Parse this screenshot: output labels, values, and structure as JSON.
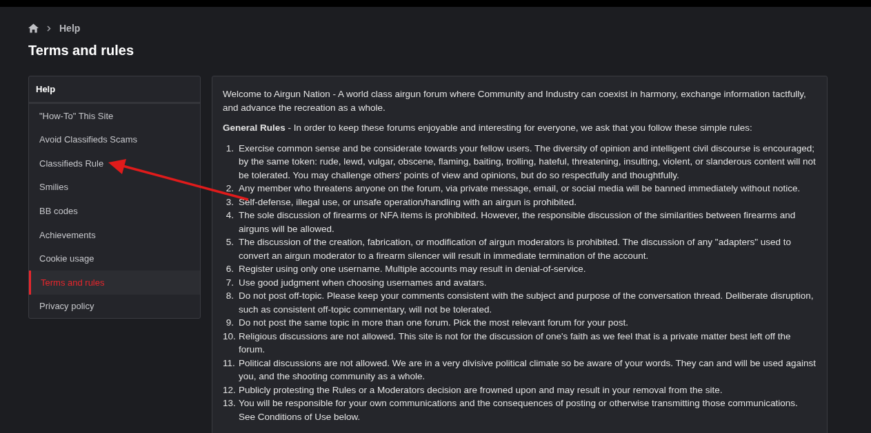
{
  "breadcrumb": {
    "home": true,
    "items": [
      "Help"
    ]
  },
  "page_title": "Terms and rules",
  "sidebar": {
    "title": "Help",
    "items": [
      {
        "label": "\"How-To\" This Site",
        "selected": false
      },
      {
        "label": "Avoid Classifieds Scams",
        "selected": false
      },
      {
        "label": "Classifieds Rule",
        "selected": false
      },
      {
        "label": "Smilies",
        "selected": false
      },
      {
        "label": "BB codes",
        "selected": false
      },
      {
        "label": "Achievements",
        "selected": false
      },
      {
        "label": "Cookie usage",
        "selected": false
      },
      {
        "label": "Terms and rules",
        "selected": true
      },
      {
        "label": "Privacy policy",
        "selected": false
      }
    ]
  },
  "content": {
    "intro": "Welcome to Airgun Nation - A world class airgun forum where Community and Industry can coexist in harmony, exchange information tactfully, and advance the recreation as a whole.",
    "general": "**General Rules** - In order to keep these forums enjoyable and interesting for everyone, we ask that you follow these simple rules:",
    "rules": [
      {
        "number": "1.",
        "text": "Exercise common sense and be considerate towards your fellow users. The diversity of opinion and intelligent civil discourse is encouraged; by the same token: rude, lewd, vulgar, obscene, flaming, baiting, trolling, hateful, threatening, insulting, violent, or slanderous content will not be tolerated. You may challenge others' points of view and opinions, but do so respectfully and thoughtfully."
      },
      {
        "number": "2.",
        "text": "Any member who threatens anyone on the forum, via private message, email, or social media will be banned immediately without notice."
      },
      {
        "number": "3.",
        "text": "Self-defense, illegal use, or unsafe operation/handling with an airgun is prohibited."
      },
      {
        "number": "4.",
        "text": "The sole discussion of firearms or NFA items is prohibited. However, the responsible discussion of the similarities between firearms and airguns will be allowed."
      },
      {
        "number": "5.",
        "text": "The discussion of the creation, fabrication, or modification of airgun moderators is prohibited. The discussion of any \"adapters\" used to convert an airgun moderator to a firearm silencer will result in immediate termination of the account."
      },
      {
        "number": "6.",
        "text": "Register using only one username. Multiple accounts may result in denial-of-service."
      },
      {
        "number": "7.",
        "text": "Use good judgment when choosing usernames and avatars."
      },
      {
        "number": "8.",
        "text": "Do not post off-topic. Please keep your comments consistent with the subject and purpose of the conversation thread. Deliberate disruption, such as consistent off-topic commentary, will not be tolerated."
      },
      {
        "number": "9.",
        "text": "Do not post the same topic in more than one forum. Pick the most relevant forum for your post."
      },
      {
        "number": "10.",
        "text": "Religious discussions are not allowed. This site is not for the discussion of one's faith as we feel that is a private matter best left off the forum."
      },
      {
        "number": "11.",
        "text": "Political discussions are not allowed. We are in a very divisive political climate so be aware of your words. They can and will be used against you, and the shooting community as a whole."
      },
      {
        "number": "12.",
        "text": "Publicly protesting the Rules or a Moderators decision are frowned upon and may result in your removal from the site."
      },
      {
        "number": "13.",
        "text": "You will be responsible for your own communications and the consequences of posting or otherwise transmitting those communications. See Conditions of Use below."
      }
    ]
  },
  "annotation": {
    "kind": "arrow"
  }
}
